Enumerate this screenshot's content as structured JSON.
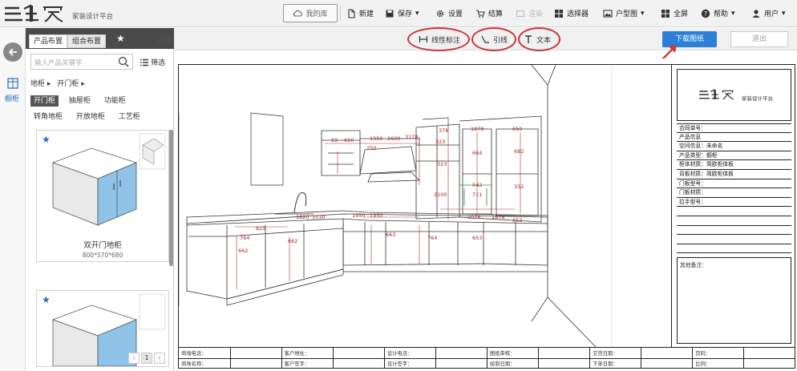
{
  "app": {
    "logo_glyph": "三维家",
    "logo_tagline": "家装设计平台"
  },
  "toolbar": {
    "library": "我的库",
    "new": "新建",
    "save": "保存",
    "settings": "设置",
    "checkout": "结算",
    "render": "渲染",
    "selector": "选择器",
    "floorplan": "户型图",
    "fullscreen": "全屏",
    "help": "帮助",
    "user": "用户"
  },
  "left_rail": {
    "cabinet_label": "橱柜"
  },
  "panel": {
    "tab_products": "产品布置",
    "tab_combo": "组合布置",
    "view": "视图",
    "search_placeholder": "输入产品关键字",
    "filter": "筛选",
    "breadcrumb_1": "地柜",
    "breadcrumb_2": "开门柜",
    "categories": [
      "开门柜",
      "抽屉柜",
      "功能柜",
      "转角地柜",
      "开放地柜",
      "工艺柜"
    ],
    "active_category": "开门柜",
    "products": [
      {
        "name": "双开门地柜",
        "dims": "800*570*680"
      },
      {
        "name": "",
        "dims": ""
      }
    ],
    "pager": {
      "prev": "‹",
      "page": "1",
      "next": "›"
    }
  },
  "subbar": {
    "linear_dimension": "线性标注",
    "leader": "引线",
    "text": "文本",
    "download": "下载图纸",
    "exit": "退出"
  },
  "drawing": {
    "dimension_labels": [
      "50",
      "650",
      "1950",
      "2600",
      "3178",
      "378",
      "1878",
      "650",
      "250",
      "323",
      "664",
      "682",
      "323",
      "2100",
      "542",
      "352",
      "711",
      "1820",
      "1030",
      "1950",
      "1950",
      "2078",
      "1878",
      "653",
      "825",
      "764",
      "662",
      "662",
      "663",
      "764",
      "653"
    ]
  },
  "titleblock": {
    "logo_glyph": "三维家",
    "logo_tagline": "家装设计平台",
    "rows": [
      "合同单号：",
      "产品信息",
      "空间信息：未命名",
      "产品类型：橱柜",
      "柜体材质：简欧柜体板",
      "背板材质：简欧柜体板",
      "门板型号：",
      "门板材质：",
      "拉手型号：",
      "",
      "",
      "",
      "",
      ""
    ],
    "remarks": "其他备注："
  },
  "footer": {
    "row1": [
      "商场电话：",
      "客户地址：",
      "设计电话：",
      "图纸审核：",
      "交货日期：",
      "页码："
    ],
    "row2": [
      "商场名称：",
      "客户签字：",
      "设计签字：",
      "绘制日期：",
      "下单日期：",
      "比例："
    ]
  }
}
